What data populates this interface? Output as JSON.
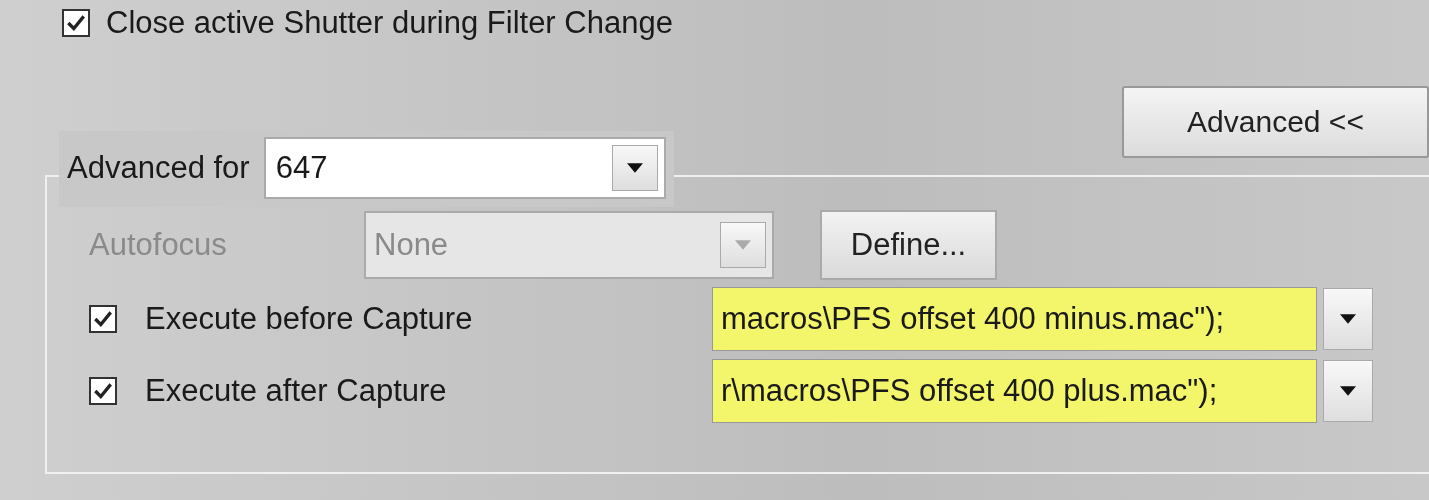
{
  "top_checkbox": {
    "label": "Close active Shutter during Filter Change",
    "checked": true
  },
  "advanced_button": {
    "label": "Advanced <<"
  },
  "group": {
    "legend": "Advanced for",
    "channel_dropdown": {
      "value": "647"
    },
    "autofocus": {
      "label": "Autofocus",
      "value": "None",
      "disabled": true,
      "define_button": "Define..."
    },
    "macros": [
      {
        "label": "Execute before Capture",
        "checked": true,
        "value": "macros\\PFS offset 400 minus.mac\");",
        "highlighted": true
      },
      {
        "label": "Execute after Capture",
        "checked": true,
        "value": "r\\macros\\PFS offset 400 plus.mac\");",
        "highlighted": true
      }
    ]
  }
}
